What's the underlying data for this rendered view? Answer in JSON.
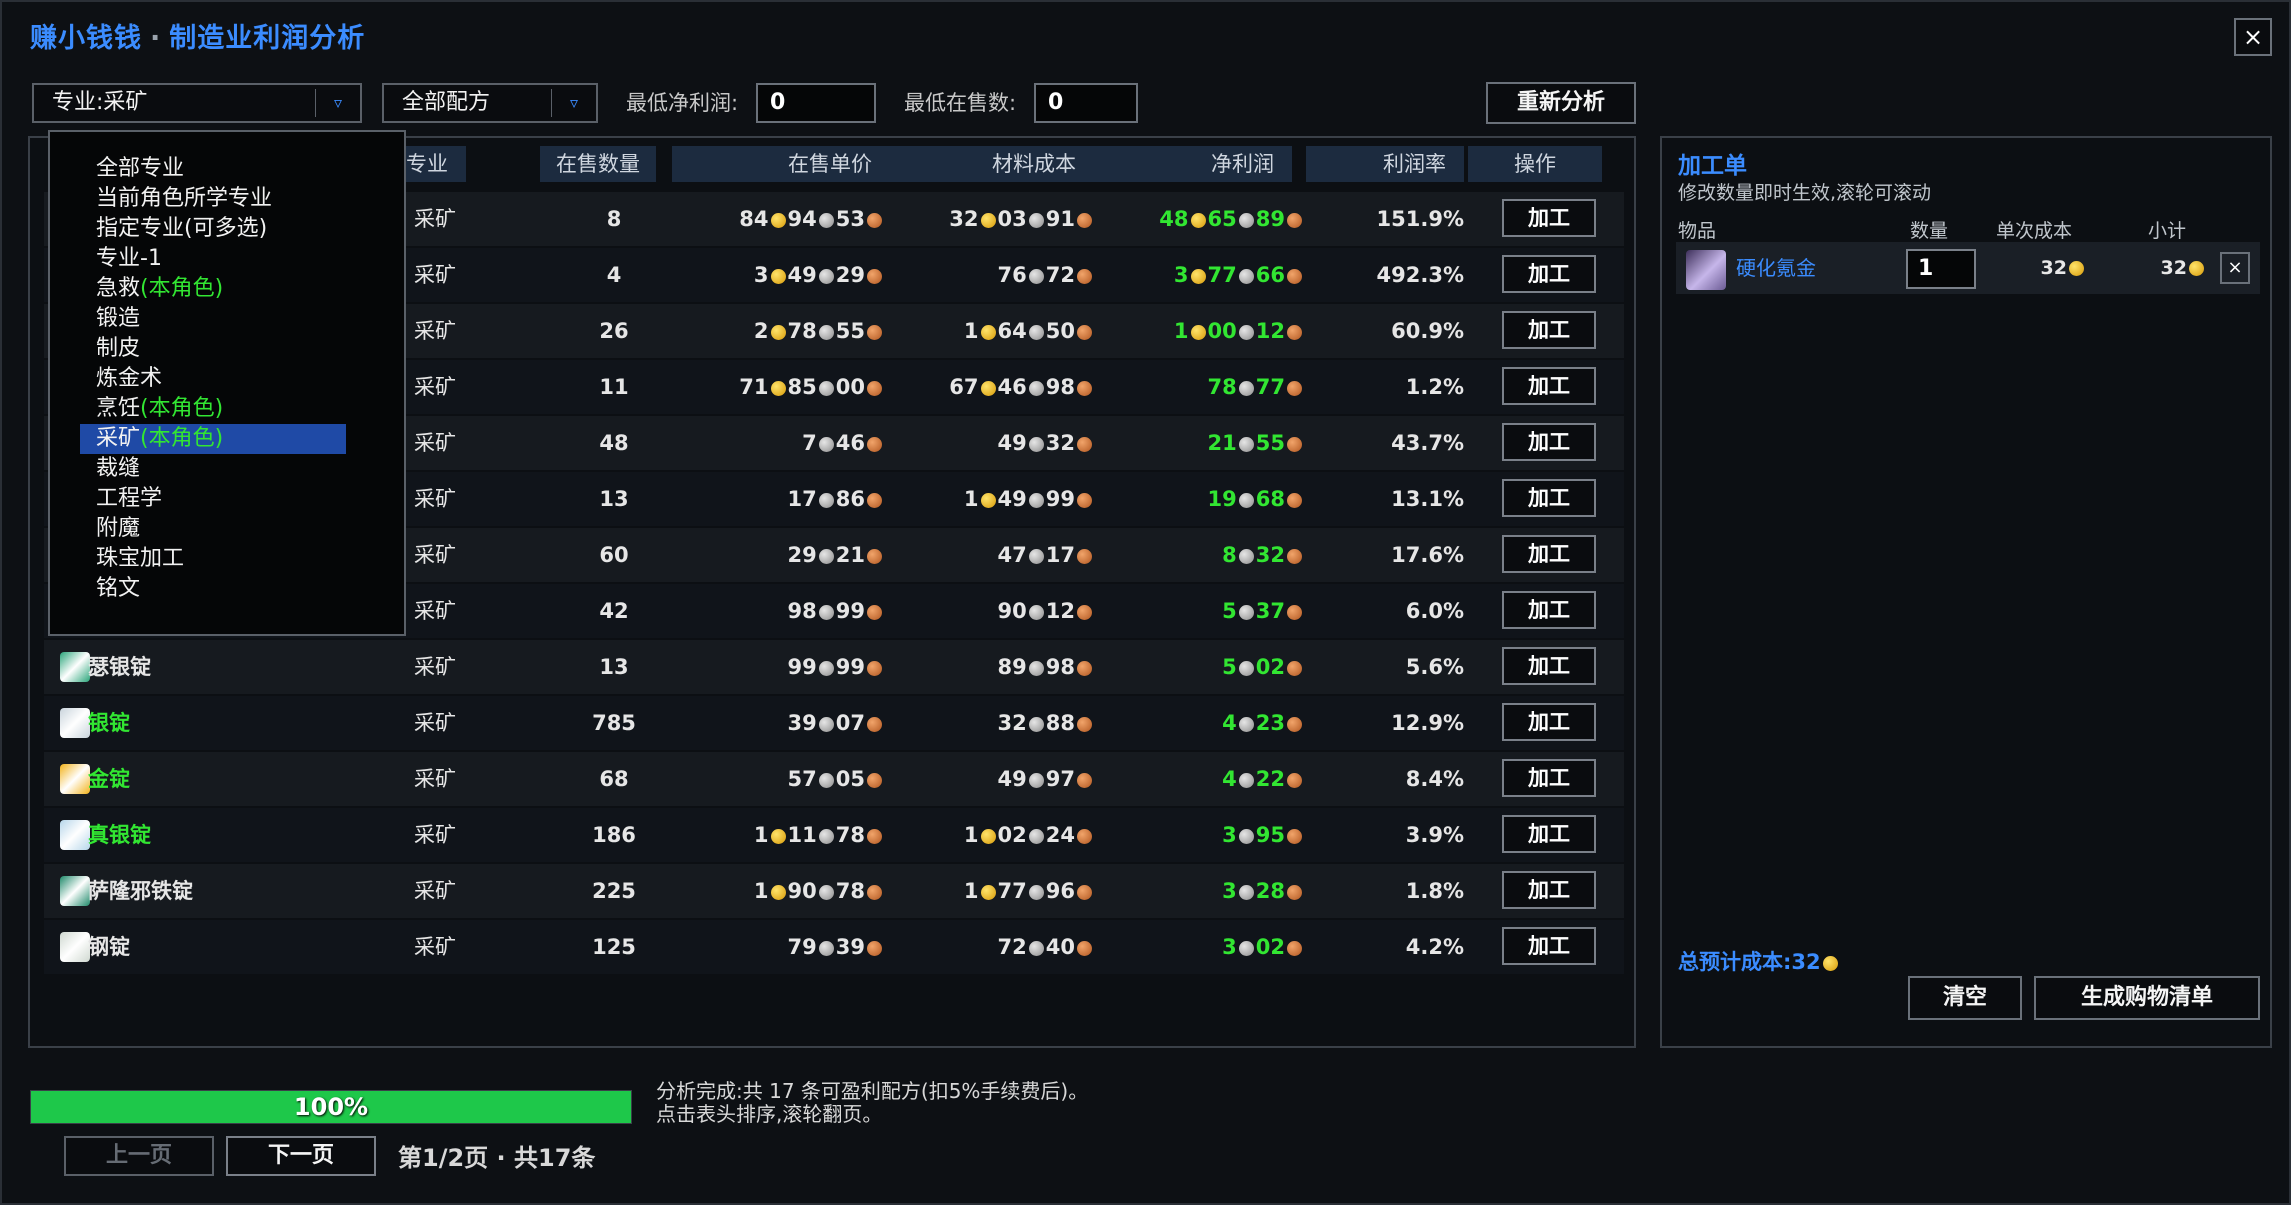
{
  "window": {
    "title_app": "赚小钱钱",
    "title_sep": "·",
    "title_page": "制造业利润分析",
    "close": "×"
  },
  "filters": {
    "profession_select": "专业:采矿",
    "recipe_select": "全部配方",
    "min_profit_label": "最低净利润:",
    "min_profit_value": "0",
    "min_listing_label": "最低在售数:",
    "min_listing_value": "0",
    "reanalyze": "重新分析",
    "arrow": "▿"
  },
  "table": {
    "headers": {
      "profession": "专业",
      "qty": "在售数量",
      "price": "在售单价",
      "cost": "材料成本",
      "profit": "净利润",
      "rate": "利润率",
      "op": "操作"
    },
    "op_label": "加工",
    "rows": [
      {
        "name": "",
        "prof": "采矿",
        "qty": "8",
        "price": [
          {
            "v": "84",
            "c": "g"
          },
          {
            "v": "94",
            "c": "s"
          },
          {
            "v": "53",
            "c": "c"
          }
        ],
        "cost": [
          {
            "v": "32",
            "c": "g"
          },
          {
            "v": "03",
            "c": "s"
          },
          {
            "v": "91",
            "c": "c"
          }
        ],
        "profit": [
          {
            "v": "48",
            "c": "g"
          },
          {
            "v": "65",
            "c": "s"
          },
          {
            "v": "89",
            "c": "c"
          }
        ],
        "rate": "151.9%"
      },
      {
        "name": "",
        "prof": "采矿",
        "qty": "4",
        "price": [
          {
            "v": "3",
            "c": "g"
          },
          {
            "v": "49",
            "c": "s"
          },
          {
            "v": "29",
            "c": "c"
          }
        ],
        "cost": [
          {
            "v": "76",
            "c": "s"
          },
          {
            "v": "72",
            "c": "c"
          }
        ],
        "profit": [
          {
            "v": "3",
            "c": "g"
          },
          {
            "v": "77",
            "c": "s"
          },
          {
            "v": "66",
            "c": "c"
          }
        ],
        "rate": "492.3%"
      },
      {
        "name": "",
        "prof": "采矿",
        "qty": "26",
        "price": [
          {
            "v": "2",
            "c": "g"
          },
          {
            "v": "78",
            "c": "s"
          },
          {
            "v": "55",
            "c": "c"
          }
        ],
        "cost": [
          {
            "v": "1",
            "c": "g"
          },
          {
            "v": "64",
            "c": "s"
          },
          {
            "v": "50",
            "c": "c"
          }
        ],
        "profit": [
          {
            "v": "1",
            "c": "g"
          },
          {
            "v": "00",
            "c": "s"
          },
          {
            "v": "12",
            "c": "c"
          }
        ],
        "rate": "60.9%"
      },
      {
        "name": "",
        "prof": "采矿",
        "qty": "11",
        "price": [
          {
            "v": "71",
            "c": "g"
          },
          {
            "v": "85",
            "c": "s"
          },
          {
            "v": "00",
            "c": "c"
          }
        ],
        "cost": [
          {
            "v": "67",
            "c": "g"
          },
          {
            "v": "46",
            "c": "s"
          },
          {
            "v": "98",
            "c": "c"
          }
        ],
        "profit": [
          {
            "v": "78",
            "c": "s"
          },
          {
            "v": "77",
            "c": "c"
          }
        ],
        "rate": "1.2%"
      },
      {
        "name": "",
        "prof": "采矿",
        "qty": "48",
        "price": [
          {
            "v": "7",
            "c": "s"
          },
          {
            "v": "46",
            "c": "c"
          }
        ],
        "cost": [
          {
            "v": "49",
            "c": "s"
          },
          {
            "v": "32",
            "c": "c"
          }
        ],
        "profit": [
          {
            "v": "21",
            "c": "s"
          },
          {
            "v": "55",
            "c": "c"
          }
        ],
        "rate": "43.7%"
      },
      {
        "name": "",
        "prof": "采矿",
        "qty": "13",
        "price": [
          {
            "v": "17",
            "c": "s"
          },
          {
            "v": "86",
            "c": "c"
          }
        ],
        "cost": [
          {
            "v": "1",
            "c": "g"
          },
          {
            "v": "49",
            "c": "s"
          },
          {
            "v": "99",
            "c": "c"
          }
        ],
        "profit": [
          {
            "v": "19",
            "c": "s"
          },
          {
            "v": "68",
            "c": "c"
          }
        ],
        "rate": "13.1%"
      },
      {
        "name": "",
        "prof": "采矿",
        "qty": "60",
        "price": [
          {
            "v": "29",
            "c": "s"
          },
          {
            "v": "21",
            "c": "c"
          }
        ],
        "cost": [
          {
            "v": "47",
            "c": "s"
          },
          {
            "v": "17",
            "c": "c"
          }
        ],
        "profit": [
          {
            "v": "8",
            "c": "s"
          },
          {
            "v": "32",
            "c": "c"
          }
        ],
        "rate": "17.6%"
      },
      {
        "name": "",
        "prof": "采矿",
        "qty": "42",
        "price": [
          {
            "v": "98",
            "c": "s"
          },
          {
            "v": "99",
            "c": "c"
          }
        ],
        "cost": [
          {
            "v": "90",
            "c": "s"
          },
          {
            "v": "12",
            "c": "c"
          }
        ],
        "profit": [
          {
            "v": "5",
            "c": "s"
          },
          {
            "v": "37",
            "c": "c"
          }
        ],
        "rate": "6.0%"
      },
      {
        "name": "瑟银锭",
        "nameColor": "#e6e6e6",
        "icon": "#2aa57a",
        "prof": "采矿",
        "qty": "13",
        "price": [
          {
            "v": "99",
            "c": "s"
          },
          {
            "v": "99",
            "c": "c"
          }
        ],
        "cost": [
          {
            "v": "89",
            "c": "s"
          },
          {
            "v": "98",
            "c": "c"
          }
        ],
        "profit": [
          {
            "v": "5",
            "c": "s"
          },
          {
            "v": "02",
            "c": "c"
          }
        ],
        "rate": "5.6%"
      },
      {
        "name": "银锭",
        "nameColor": "#32e632",
        "icon": "#c9d4dc",
        "prof": "采矿",
        "qty": "785",
        "price": [
          {
            "v": "39",
            "c": "s"
          },
          {
            "v": "07",
            "c": "c"
          }
        ],
        "cost": [
          {
            "v": "32",
            "c": "s"
          },
          {
            "v": "88",
            "c": "c"
          }
        ],
        "profit": [
          {
            "v": "4",
            "c": "s"
          },
          {
            "v": "23",
            "c": "c"
          }
        ],
        "rate": "12.9%"
      },
      {
        "name": "金锭",
        "nameColor": "#32e632",
        "icon": "#f2b21a",
        "prof": "采矿",
        "qty": "68",
        "price": [
          {
            "v": "57",
            "c": "s"
          },
          {
            "v": "05",
            "c": "c"
          }
        ],
        "cost": [
          {
            "v": "49",
            "c": "s"
          },
          {
            "v": "97",
            "c": "c"
          }
        ],
        "profit": [
          {
            "v": "4",
            "c": "s"
          },
          {
            "v": "22",
            "c": "c"
          }
        ],
        "rate": "8.4%"
      },
      {
        "name": "真银锭",
        "nameColor": "#32e632",
        "icon": "#b6d6ea",
        "prof": "采矿",
        "qty": "186",
        "price": [
          {
            "v": "1",
            "c": "g"
          },
          {
            "v": "11",
            "c": "s"
          },
          {
            "v": "78",
            "c": "c"
          }
        ],
        "cost": [
          {
            "v": "1",
            "c": "g"
          },
          {
            "v": "02",
            "c": "s"
          },
          {
            "v": "24",
            "c": "c"
          }
        ],
        "profit": [
          {
            "v": "3",
            "c": "s"
          },
          {
            "v": "95",
            "c": "c"
          }
        ],
        "rate": "3.9%"
      },
      {
        "name": "萨隆邪铁锭",
        "nameColor": "#e6e6e6",
        "icon": "#1f8a6a",
        "prof": "采矿",
        "qty": "225",
        "price": [
          {
            "v": "1",
            "c": "g"
          },
          {
            "v": "90",
            "c": "s"
          },
          {
            "v": "78",
            "c": "c"
          }
        ],
        "cost": [
          {
            "v": "1",
            "c": "g"
          },
          {
            "v": "77",
            "c": "s"
          },
          {
            "v": "96",
            "c": "c"
          }
        ],
        "profit": [
          {
            "v": "3",
            "c": "s"
          },
          {
            "v": "28",
            "c": "c"
          }
        ],
        "rate": "1.8%"
      },
      {
        "name": "钢锭",
        "nameColor": "#e6e6e6",
        "icon": "#cfd8d0",
        "prof": "采矿",
        "qty": "125",
        "price": [
          {
            "v": "79",
            "c": "s"
          },
          {
            "v": "39",
            "c": "c"
          }
        ],
        "cost": [
          {
            "v": "72",
            "c": "s"
          },
          {
            "v": "40",
            "c": "c"
          }
        ],
        "profit": [
          {
            "v": "3",
            "c": "s"
          },
          {
            "v": "02",
            "c": "c"
          }
        ],
        "rate": "4.2%"
      }
    ]
  },
  "dropdown": {
    "items": [
      {
        "label": "全部专业",
        "tag": ""
      },
      {
        "label": "当前角色所学专业",
        "tag": ""
      },
      {
        "label": "指定专业(可多选)",
        "tag": ""
      },
      {
        "label": "专业-1",
        "tag": ""
      },
      {
        "label": "急救",
        "tag": "(本角色)"
      },
      {
        "label": "锻造",
        "tag": ""
      },
      {
        "label": "制皮",
        "tag": ""
      },
      {
        "label": "炼金术",
        "tag": ""
      },
      {
        "label": "烹饪",
        "tag": "(本角色)"
      },
      {
        "label": "采矿",
        "tag": "(本角色)",
        "selected": true
      },
      {
        "label": "裁缝",
        "tag": ""
      },
      {
        "label": "工程学",
        "tag": ""
      },
      {
        "label": "附魔",
        "tag": ""
      },
      {
        "label": "珠宝加工",
        "tag": ""
      },
      {
        "label": "铭文",
        "tag": ""
      }
    ]
  },
  "side": {
    "title": "加工单",
    "subtitle": "修改数量即时生效,滚轮可滚动",
    "headers": {
      "item": "物品",
      "qty": "数量",
      "unit": "单次成本",
      "subtotal": "小计"
    },
    "item": {
      "name": "硬化氪金",
      "qty": "1",
      "unit": "32",
      "subtotal": "32",
      "remove": "×"
    },
    "total_label": "总预计成本:32",
    "clear": "清空",
    "shopping": "生成购物清单"
  },
  "footer": {
    "progress_text": "100%",
    "progress_value": 1.0,
    "status_line1": "分析完成:共 17 条可盈利配方(扣5%手续费后)。",
    "status_line2": "点击表头排序,滚轮翻页。",
    "prev": "上一页",
    "next": "下一页",
    "page_info": "第1/2页 · 共17条"
  },
  "colors": {
    "accent": "#3b8cff",
    "positive": "#32e632",
    "progress": "#1ec84a"
  }
}
